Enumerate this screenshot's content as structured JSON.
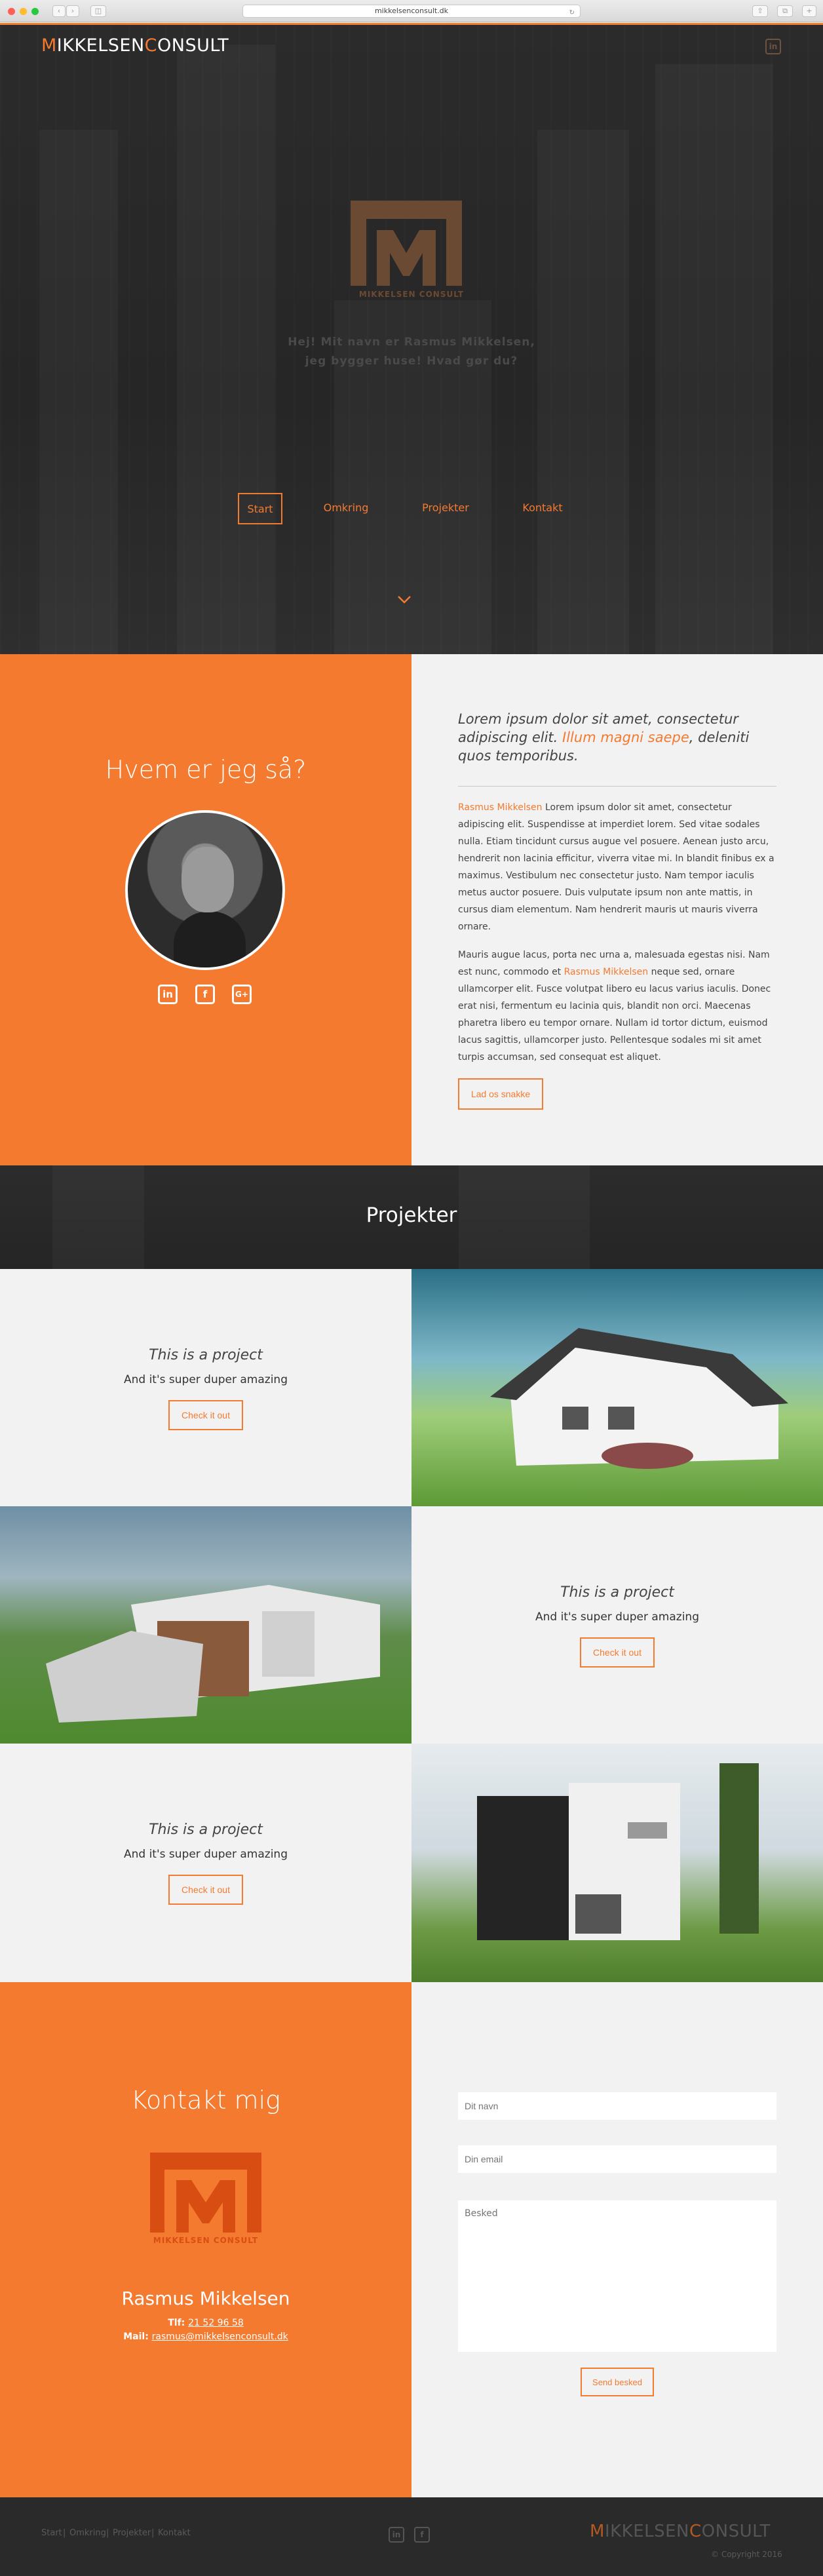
{
  "browser": {
    "url": "mikkelsenconsult.dk",
    "traffic_lights": [
      "#ff5f57",
      "#febc2e",
      "#28c840"
    ]
  },
  "brand": {
    "part1": "M",
    "part2": "IKKELSEN",
    "part3": "C",
    "part4": "ONSULT"
  },
  "hero": {
    "logo_text": "MIKKELSEN CONSULT",
    "line1": "Hej! Mit navn er Rasmus Mikkelsen,",
    "line2": "jeg bygger huse! Hvad gør du?",
    "nav": [
      "Start",
      "Omkring",
      "Projekter",
      "Kontakt"
    ]
  },
  "about": {
    "title": "Hvem er jeg så?",
    "lead_1": "Lorem ipsum dolor sit amet, consectetur adipiscing elit. ",
    "lead_hl": "Illum magni saepe",
    "lead_2": ", deleniti quos temporibus.",
    "p1_name": "Rasmus Mikkelsen",
    "p1": " Lorem ipsum dolor sit amet, consectetur adipiscing elit. Suspendisse at imperdiet lorem. Sed vitae sodales nulla. Etiam tincidunt cursus augue vel posuere. Aenean justo arcu, hendrerit non lacinia efficitur, viverra vitae mi. In blandit finibus ex a maximus. Vestibulum nec consectetur justo. Nam tempor iaculis metus auctor posuere. Duis vulputate ipsum non ante mattis, in cursus diam elementum. Nam hendrerit mauris ut mauris viverra ornare.",
    "p2_a": "Mauris augue lacus, porta nec urna a, malesuada egestas nisi. Nam est nunc, commodo et ",
    "p2_name": "Rasmus Mikkelsen",
    "p2_b": " neque sed, ornare ullamcorper elit. Fusce volutpat libero eu lacus varius iaculis. Donec erat nisi, fermentum eu lacinia quis, blandit non orci. Maecenas pharetra libero eu tempor ornare. Nullam id tortor dictum, euismod lacus sagittis, ullamcorper justo. Pellentesque sodales mi sit amet turpis accumsan, sed consequat est aliquet.",
    "cta": "Lad os snakke"
  },
  "projects": {
    "title": "Projekter",
    "items": [
      {
        "title": "This is a project",
        "subtitle": "And it's super duper amazing",
        "button": "Check it out"
      },
      {
        "title": "This is a project",
        "subtitle": "And it's super duper amazing",
        "button": "Check it out"
      },
      {
        "title": "This is a project",
        "subtitle": "And it's super duper amazing",
        "button": "Check it out"
      }
    ]
  },
  "contact": {
    "title": "Kontakt mig",
    "logo_text": "MIKKELSEN CONSULT",
    "name": "Rasmus Mikkelsen",
    "phone_label": "Tlf: ",
    "phone": "21 52 96 58",
    "mail_label": "Mail: ",
    "mail": "rasmus@mikkelsenconsult.dk",
    "placeholder_name": "Dit navn",
    "placeholder_email": "Din email",
    "placeholder_message": "Besked",
    "send": "Send besked"
  },
  "footer": {
    "links": [
      "Start",
      "Omkring",
      "Projekter",
      "Kontakt"
    ],
    "separator": "|",
    "copyright": "© Copyright 2016"
  },
  "colors": {
    "accent": "#f47a30",
    "dark": "#2a2a2a",
    "light": "#f2f2f2"
  }
}
